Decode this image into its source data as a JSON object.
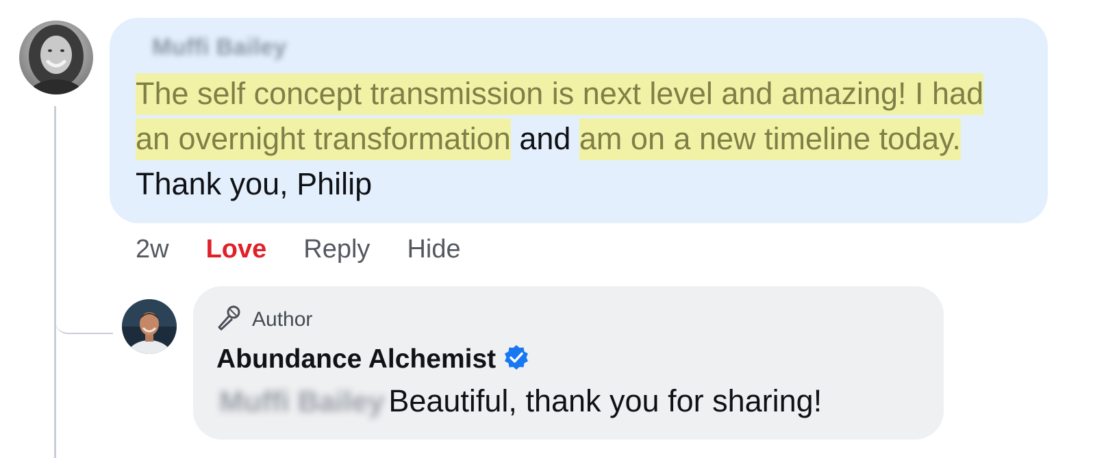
{
  "main_comment": {
    "commenter_name": "Muffi Bailey",
    "text_segments": [
      {
        "text": "The self concept transmission is next level and amazing! I had an overnight transformation",
        "highlight": true
      },
      {
        "text": " and ",
        "highlight": false
      },
      {
        "text": "am on a new timeline today.",
        "highlight": true
      },
      {
        "text": " Thank you, Philip",
        "highlight": false
      }
    ],
    "highlight_color": "#f1f2a6",
    "bubble_color": "#e4effd"
  },
  "actions": {
    "time": "2w",
    "love": "Love",
    "reply": "Reply",
    "hide": "Hide",
    "love_color": "#e0202a"
  },
  "reply_comment": {
    "author_label": "Author",
    "author_icon": "microphone-icon",
    "name": "Abundance Alchemist",
    "verified_icon": "verified-badge-icon",
    "verified_color": "#1877f2",
    "mention": "Muffi Bailey",
    "text": "Beautiful, thank you for sharing!",
    "bubble_color": "#eff0f2"
  }
}
